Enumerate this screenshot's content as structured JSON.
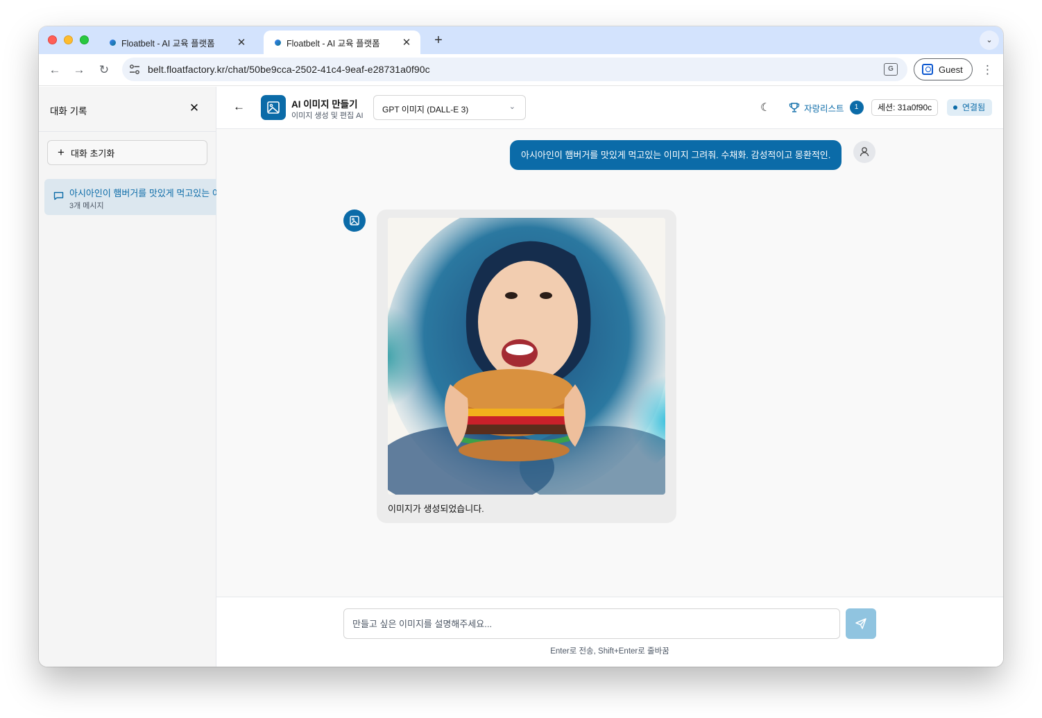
{
  "browser": {
    "tabs": [
      {
        "title": "Floatbelt - AI 교육 플랫폼",
        "active": false
      },
      {
        "title": "Floatbelt - AI 교육 플랫폼",
        "active": true
      }
    ],
    "url": "belt.floatfactory.kr/chat/50be9cca-2502-41c4-9eaf-e28731a0f90c",
    "profile_label": "Guest"
  },
  "sidebar": {
    "title": "대화 기록",
    "reset_label": "대화 초기화",
    "conversations": [
      {
        "title": "아시아인이 햄버거를 맛있게 먹고있는 이미지",
        "meta": "3개 메시지"
      }
    ]
  },
  "header": {
    "app_name": "AI 이미지 만들기",
    "app_subtitle": "이미지 생성 및 편집 AI",
    "model": "GPT 이미지 (DALL-E 3)",
    "favorites_label": "자랑리스트",
    "favorites_count": "1",
    "session": "세션: 31a0f90c",
    "status": "연결됨"
  },
  "chat": {
    "user_message": "아시아인이 햄버거를 맛있게 먹고있는 이미지 그려줘. 수채화. 감성적이고 몽환적인.",
    "bot_message": "이미지가 생성되었습니다."
  },
  "input": {
    "placeholder": "만들고 싶은 이미지를 설명해주세요...",
    "hint": "Enter로 전송, Shift+Enter로 줄바꿈"
  },
  "colors": {
    "accent": "#0b6ba8",
    "send_button": "#90c4e0",
    "tab_strip": "#d3e3fd"
  }
}
